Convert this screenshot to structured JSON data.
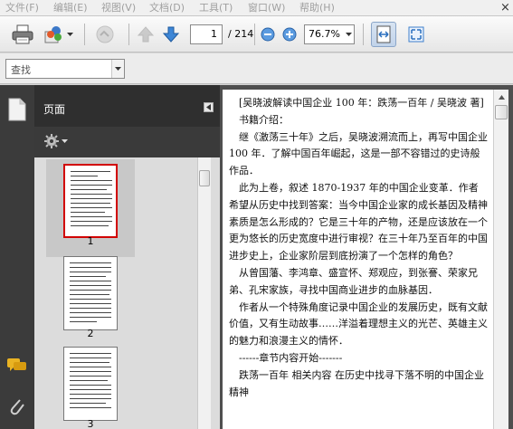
{
  "menu": [
    {
      "label": "文件(F)"
    },
    {
      "label": "编辑(E)"
    },
    {
      "label": "视图(V)"
    },
    {
      "label": "文档(D)"
    },
    {
      "label": "工具(T)"
    },
    {
      "label": "窗口(W)"
    },
    {
      "label": "帮助(H)"
    }
  ],
  "menu_close": "×",
  "toolbar": {
    "page_current": "1",
    "page_total": "/ 214",
    "zoom": "76.7%",
    "icons": [
      "print-icon",
      "share-icon",
      "sign-icon",
      "previous-page-icon",
      "next-page-icon",
      "zoom-out-icon",
      "zoom-in-icon",
      "fit-width-icon",
      "full-screen-icon"
    ]
  },
  "find": {
    "placeholder": "查找"
  },
  "panel": {
    "title": "页面",
    "thumbnails": [
      {
        "label": "1"
      },
      {
        "label": "2"
      },
      {
        "label": "3"
      }
    ]
  },
  "document": {
    "paragraphs": [
      "　[吴晓波解读中国企业 100 年：跌荡一百年 / 吴晓波 著]",
      "　书籍介绍：",
      "　继《激荡三十年》之后，吴晓波溯流而上，再写中国企业 100 年．了解中国百年崛起，这是一部不容错过的史诗般作品．",
      "　此为上卷，叙述 1870-1937 年的中国企业变革．作者希望从历史中找到答案：当今中国企业家的成长基因及精神素质是怎么形成的？它是三十年的产物，还是应该放在一个更为悠长的历史宽度中进行审视？在三十年乃至百年的中国进步史上，企业家阶层到底扮演了一个怎样的角色？",
      "　从曾国藩、李鸿章、盛宣怀、郑观应，到张謇、荣家兄弟、孔宋家族，寻找中国商业进步的血脉基因．",
      "　作者从一个特殊角度记录中国企业的发展历史，既有文献价值，又有生动故事……洋溢着理想主义的光芒、英雄主义的魅力和浪漫主义的情怀．",
      "　------章节内容开始-------",
      "　跌荡一百年 相关内容 在历史中找寻下落不明的中国企业精神"
    ]
  },
  "colors": {
    "accent": "#2a6fbf",
    "panel_dark": "#2f2f2f",
    "thumb_selected": "#c8c8c8",
    "thumb_border_active": "#d10000"
  }
}
